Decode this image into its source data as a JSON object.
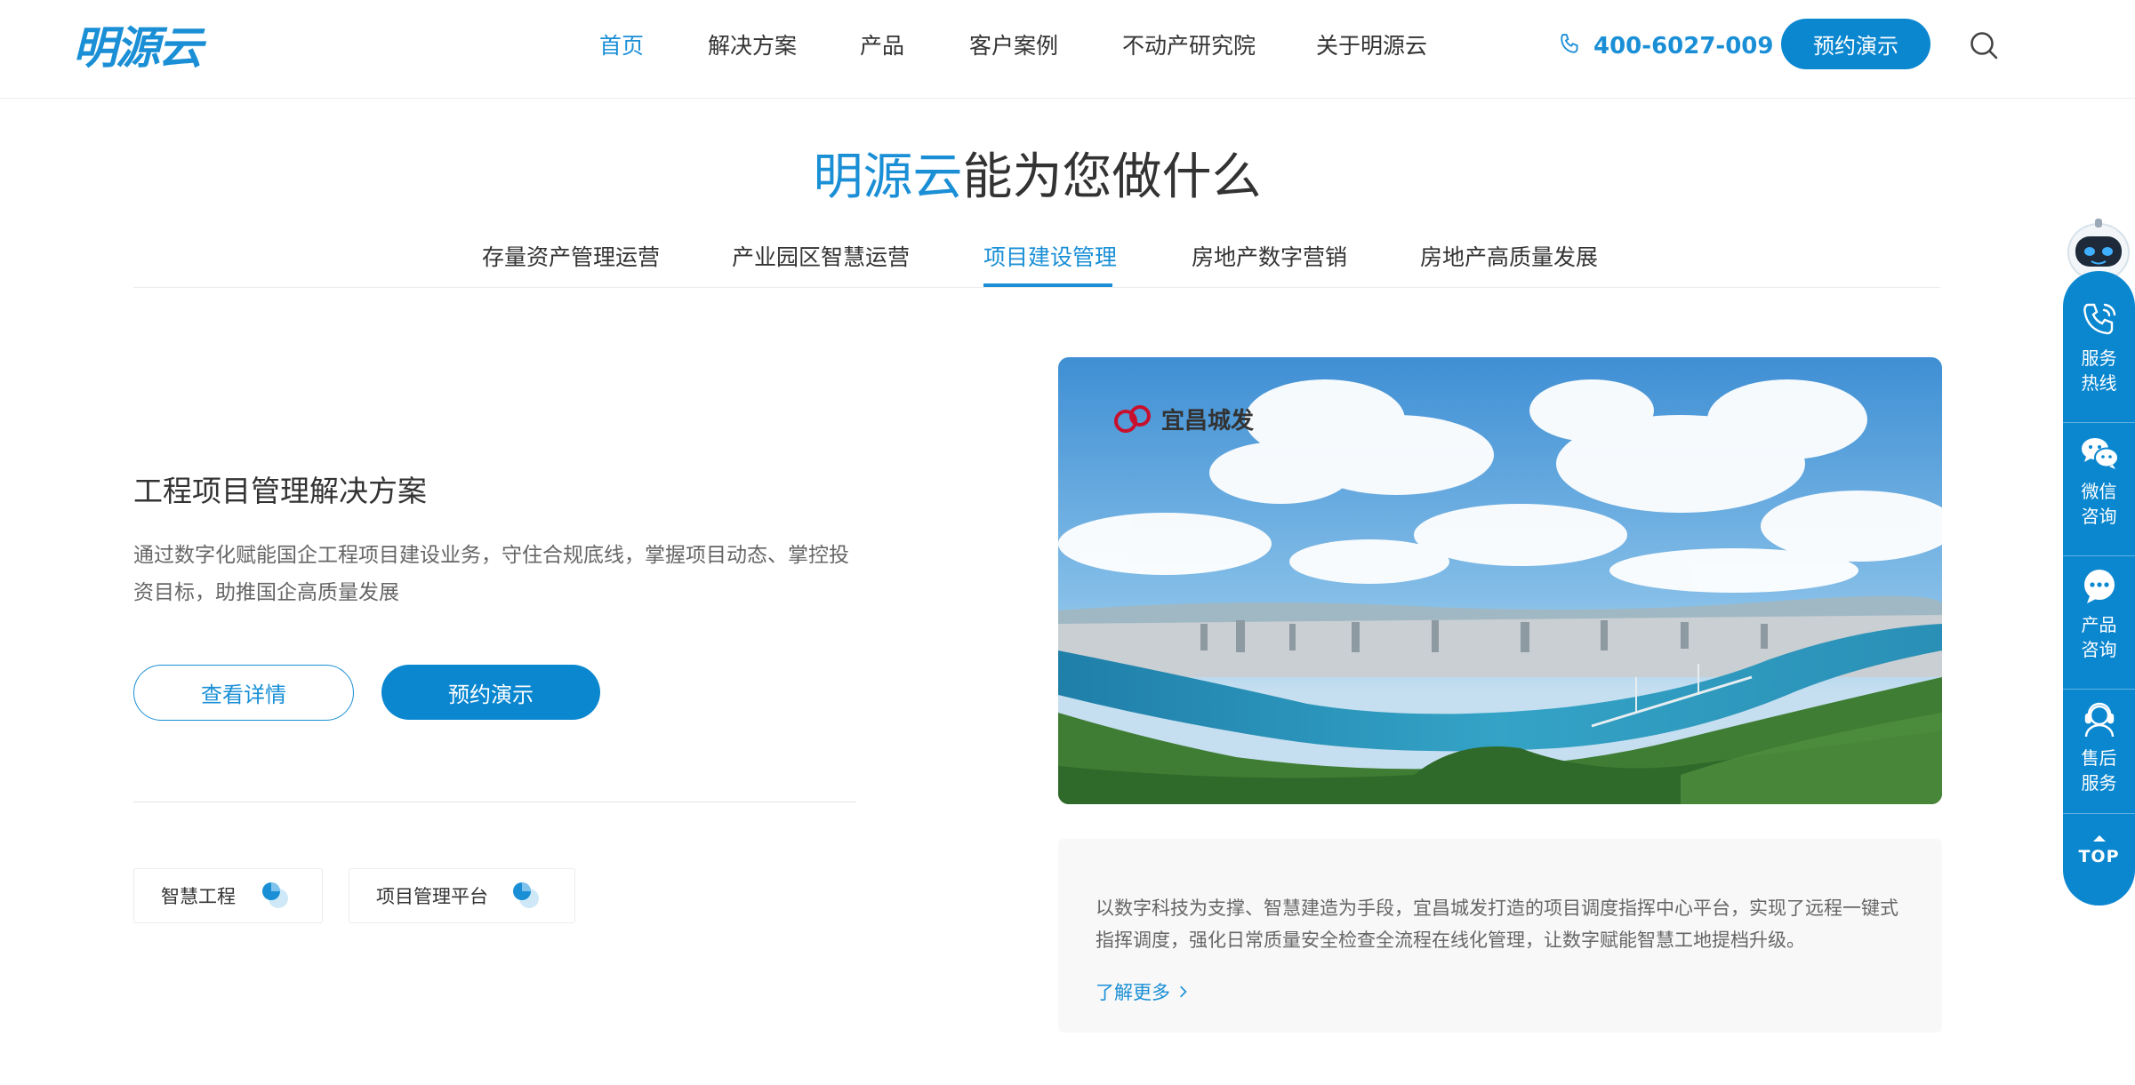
{
  "header": {
    "logo_text": "明源云",
    "nav": [
      {
        "label": "首页",
        "active": true
      },
      {
        "label": "解决方案"
      },
      {
        "label": "产品"
      },
      {
        "label": "客户案例"
      },
      {
        "label": "不动产研究院"
      },
      {
        "label": "关于明源云"
      }
    ],
    "phone": "400-6027-009",
    "demo_label": "预约演示",
    "search_icon": "search-icon"
  },
  "section": {
    "title_brand": "明源云",
    "title_rest": "能为您做什么",
    "tabs": [
      {
        "label": "存量资产管理运营"
      },
      {
        "label": "产业园区智慧运营"
      },
      {
        "label": "项目建设管理",
        "active": true
      },
      {
        "label": "房地产数字营销"
      },
      {
        "label": "房地产高质量发展"
      }
    ]
  },
  "solution": {
    "title": "工程项目管理解决方案",
    "description": "通过数字化赋能国企工程项目建设业务，守住合规底线，掌握项目动态、掌控投资目标，助推国企高质量发展",
    "details_label": "查看详情",
    "demo_label": "预约演示",
    "products": [
      {
        "label": "智慧工程"
      },
      {
        "label": "项目管理平台"
      }
    ]
  },
  "case": {
    "image_logo_text": "宜昌城发",
    "text": "以数字科技为支撑、智慧建造为手段，宜昌城发打造的项目调度指挥中心平台，实现了远程一键式指挥调度，强化日常质量安全检查全流程在线化管理，让数字赋能智慧工地提档升级。",
    "learn_more": "了解更多"
  },
  "float_bar": {
    "items": [
      {
        "label": "服务热线",
        "icon": "phone-icon"
      },
      {
        "label": "微信咨询",
        "icon": "wechat-icon"
      },
      {
        "label": "产品咨询",
        "icon": "chat-bubble-icon"
      },
      {
        "label": "售后服务",
        "icon": "support-agent-icon"
      }
    ],
    "top_label": "TOP"
  },
  "colors": {
    "brand": "#1a8fd6",
    "button": "#0b87d0",
    "text": "#333333",
    "muted": "#666666"
  }
}
